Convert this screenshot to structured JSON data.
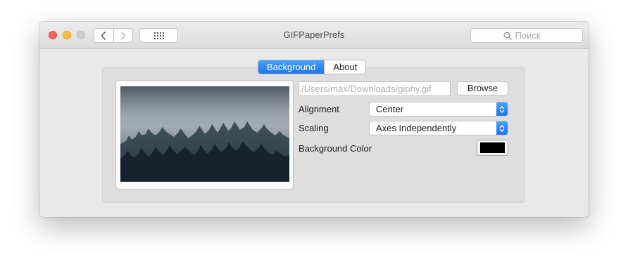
{
  "window": {
    "title": "GIFPaperPrefs",
    "search_placeholder": "Поиск"
  },
  "toolbar": {
    "back_icon": "chevron-left-icon",
    "forward_icon": "chevron-right-icon",
    "grid_icon": "grid-icon",
    "search_icon": "magnifier-icon"
  },
  "tabs": [
    {
      "label": "Background",
      "active": true
    },
    {
      "label": "About",
      "active": false
    }
  ],
  "form": {
    "path_value": "/Users/max/Downloads/giphy.gif",
    "browse_label": "Browse",
    "alignment_label": "Alignment",
    "alignment_value": "Center",
    "scaling_label": "Scaling",
    "scaling_value": "Axes Independently",
    "bg_color_label": "Background Color",
    "bg_color_value": "#000000"
  },
  "colors": {
    "accent": "#1a76ee",
    "traffic_close": "#fe5f57",
    "traffic_min": "#febc2e",
    "traffic_zoom": "#cfcfcf"
  }
}
